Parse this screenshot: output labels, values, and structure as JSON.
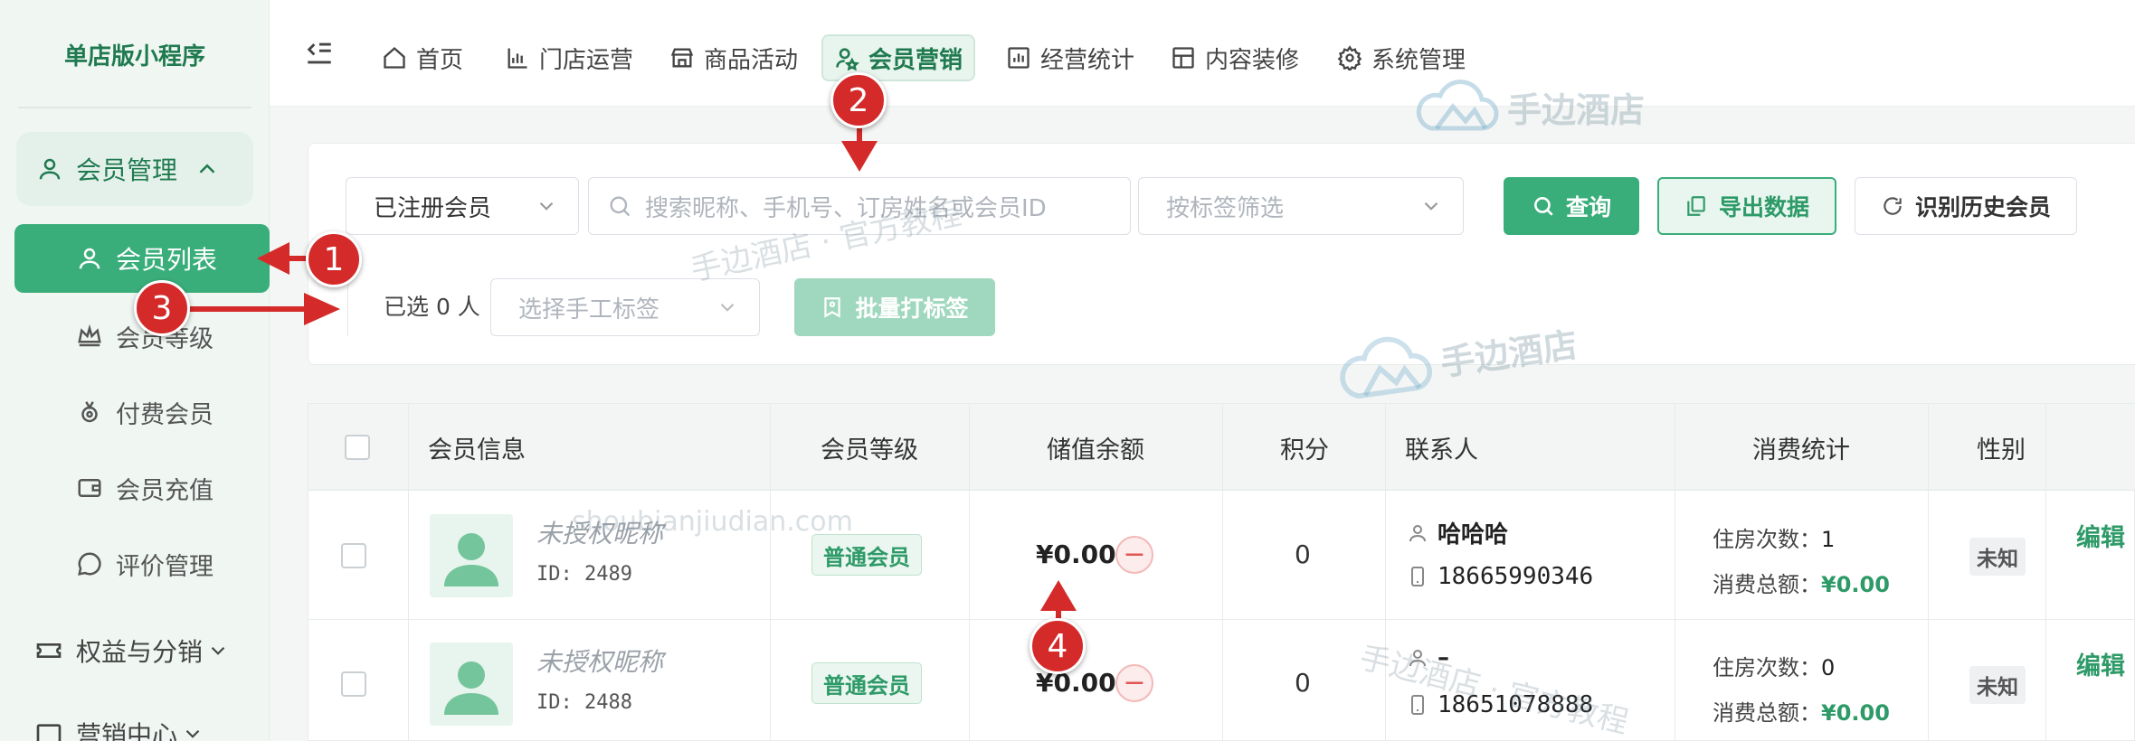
{
  "sidebar": {
    "brand": "单店版小程序",
    "group_label": "会员管理",
    "active_item": "会员列表",
    "items": [
      "会员等级",
      "付费会员",
      "会员充值",
      "评价管理"
    ],
    "sections": [
      "权益与分销",
      "营销中心"
    ]
  },
  "topnav": {
    "items": [
      "首页",
      "门店运营",
      "商品活动",
      "会员营销",
      "经营统计",
      "内容装修",
      "系统管理"
    ],
    "active": "会员营销"
  },
  "watermark": {
    "brand": "手边酒店",
    "tutorial": "手边酒店 · 官方教程",
    "domain": "shoubianjiudian.com"
  },
  "filters": {
    "member_type": "已注册会员",
    "search_placeholder": "搜索昵称、手机号、订房姓名或会员ID",
    "tag_filter_placeholder": "按标签筛选",
    "query_button": "查询",
    "export_button": "导出数据",
    "history_button": "识别历史会员",
    "selected_text": "已选 0 人",
    "manual_tag_placeholder": "选择手工标签",
    "batch_tag_button": "批量打标签"
  },
  "table": {
    "headers": [
      "会员信息",
      "会员等级",
      "储值余额",
      "积分",
      "联系人",
      "消费统计",
      "性别"
    ],
    "rows": [
      {
        "nickname": "未授权昵称",
        "id": "ID: 2489",
        "level": "普通会员",
        "balance": "¥0.00",
        "points": "0",
        "contact_name": "哈哈哈",
        "phone": "18665990346",
        "stays_label": "住房次数：",
        "stays": "1",
        "spend_label": "消费总额：",
        "spend": "¥0.00",
        "gender": "未知",
        "action": "编辑"
      },
      {
        "nickname": "未授权昵称",
        "id": "ID: 2488",
        "level": "普通会员",
        "balance": "¥0.00",
        "points": "0",
        "contact_name": "–",
        "phone": "18651078888",
        "stays_label": "住房次数：",
        "stays": "0",
        "spend_label": "消费总额：",
        "spend": "¥0.00",
        "gender": "未知",
        "action": "编辑"
      }
    ]
  },
  "annotations": [
    "1",
    "2",
    "3",
    "4"
  ],
  "colors": {
    "primary": "#3aae7a",
    "primary_dark": "#1f7a4f",
    "annotation_red": "#d42a2a"
  }
}
